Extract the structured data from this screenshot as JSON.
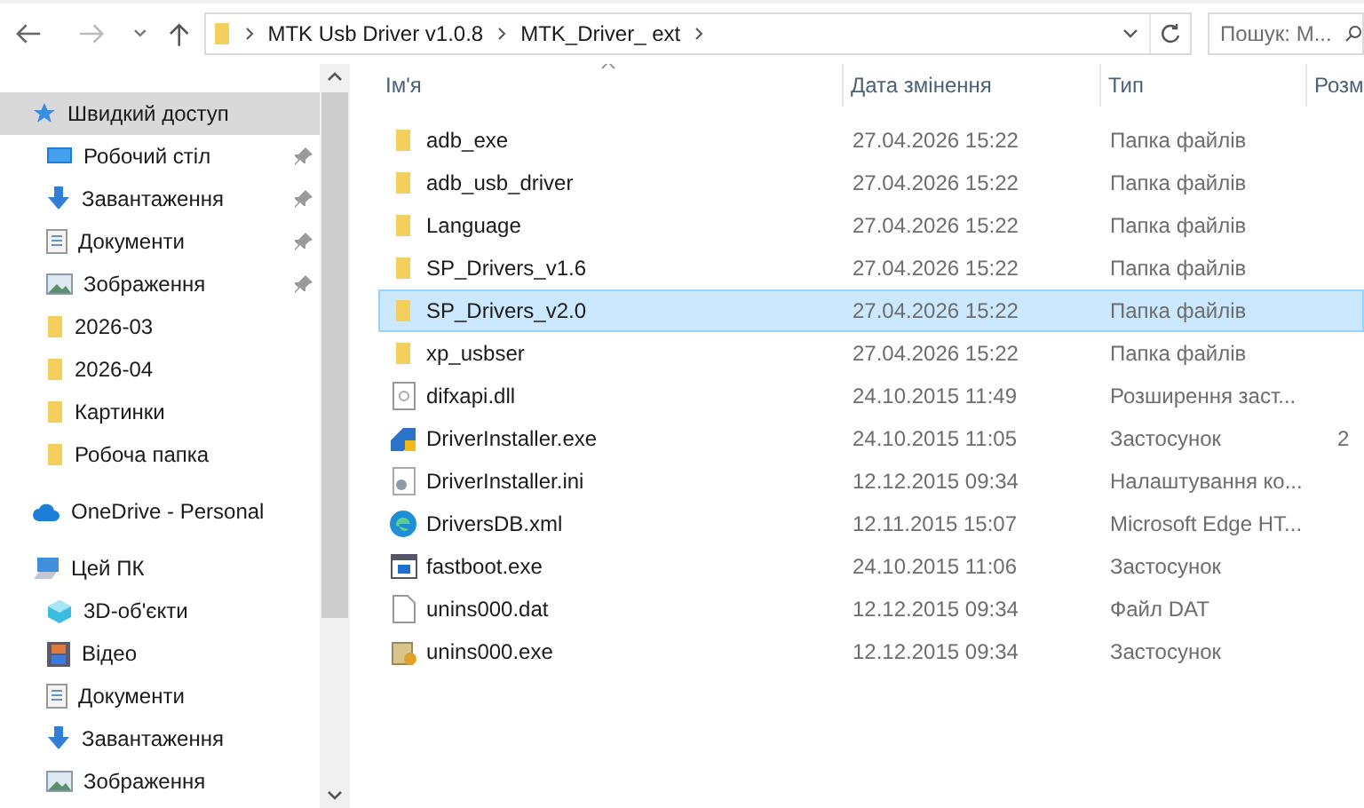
{
  "address_bar": {
    "path": [
      "MTK Usb Driver v1.0.8",
      "MTK_Driver_ ext"
    ]
  },
  "search": {
    "placeholder": "Пошук: М..."
  },
  "navigation": [
    {
      "label": "Швидкий доступ",
      "kind": "star",
      "selected": true,
      "children": [
        {
          "label": "Робочий стіл",
          "kind": "desktop",
          "pinned": true
        },
        {
          "label": "Завантаження",
          "kind": "download",
          "pinned": true
        },
        {
          "label": "Документи",
          "kind": "document",
          "pinned": true
        },
        {
          "label": "Зображення",
          "kind": "image",
          "pinned": true
        },
        {
          "label": "2026-03",
          "kind": "folder",
          "pinned": false
        },
        {
          "label": "2026-04",
          "kind": "folder",
          "pinned": false
        },
        {
          "label": "Картинки",
          "kind": "folder",
          "pinned": false
        },
        {
          "label": "Робоча папка",
          "kind": "folder",
          "pinned": false
        }
      ]
    },
    {
      "label": "OneDrive - Personal",
      "kind": "cloud",
      "selected": false
    },
    {
      "label": "Цей ПК",
      "kind": "pc",
      "selected": false,
      "children": [
        {
          "label": "3D-об'єкти",
          "kind": "cube",
          "pinned": false
        },
        {
          "label": "Відео",
          "kind": "film",
          "pinned": false
        },
        {
          "label": "Документи",
          "kind": "document",
          "pinned": false
        },
        {
          "label": "Завантаження",
          "kind": "download",
          "pinned": false
        },
        {
          "label": "Зображення",
          "kind": "image",
          "pinned": false
        }
      ]
    }
  ],
  "table": {
    "columns": [
      "Ім'я",
      "Дата змінення",
      "Тип",
      "Розм"
    ],
    "rows": [
      {
        "name": "adb_exe",
        "date": "27.04.2026 15:22",
        "type": "Папка файлів",
        "kind": "folder",
        "selected": false
      },
      {
        "name": "adb_usb_driver",
        "date": "27.04.2026 15:22",
        "type": "Папка файлів",
        "kind": "folder",
        "selected": false
      },
      {
        "name": "Language",
        "date": "27.04.2026 15:22",
        "type": "Папка файлів",
        "kind": "folder",
        "selected": false
      },
      {
        "name": "SP_Drivers_v1.6",
        "date": "27.04.2026 15:22",
        "type": "Папка файлів",
        "kind": "folder",
        "selected": false
      },
      {
        "name": "SP_Drivers_v2.0",
        "date": "27.04.2026 15:22",
        "type": "Папка файлів",
        "kind": "folder",
        "selected": true
      },
      {
        "name": "xp_usbser",
        "date": "27.04.2026 15:22",
        "type": "Папка файлів",
        "kind": "folder",
        "selected": false
      },
      {
        "name": "difxapi.dll",
        "date": "24.10.2015 11:49",
        "type": "Розширення заст...",
        "kind": "dll",
        "selected": false
      },
      {
        "name": "DriverInstaller.exe",
        "date": "24.10.2015 11:05",
        "type": "Застосунок",
        "size": "2",
        "kind": "installer",
        "selected": false
      },
      {
        "name": "DriverInstaller.ini",
        "date": "12.12.2015 09:34",
        "type": "Налаштування ко...",
        "kind": "ini",
        "selected": false
      },
      {
        "name": "DriversDB.xml",
        "date": "12.11.2015 15:07",
        "type": "Microsoft Edge HT...",
        "kind": "edge",
        "selected": false
      },
      {
        "name": "fastboot.exe",
        "date": "24.10.2015 11:06",
        "type": "Застосунок",
        "kind": "app",
        "selected": false
      },
      {
        "name": "unins000.dat",
        "date": "12.12.2015 09:34",
        "type": "Файл DAT",
        "kind": "file",
        "selected": false
      },
      {
        "name": "unins000.exe",
        "date": "12.12.2015 09:34",
        "type": "Застосунок",
        "kind": "uninstaller",
        "selected": false
      }
    ]
  }
}
